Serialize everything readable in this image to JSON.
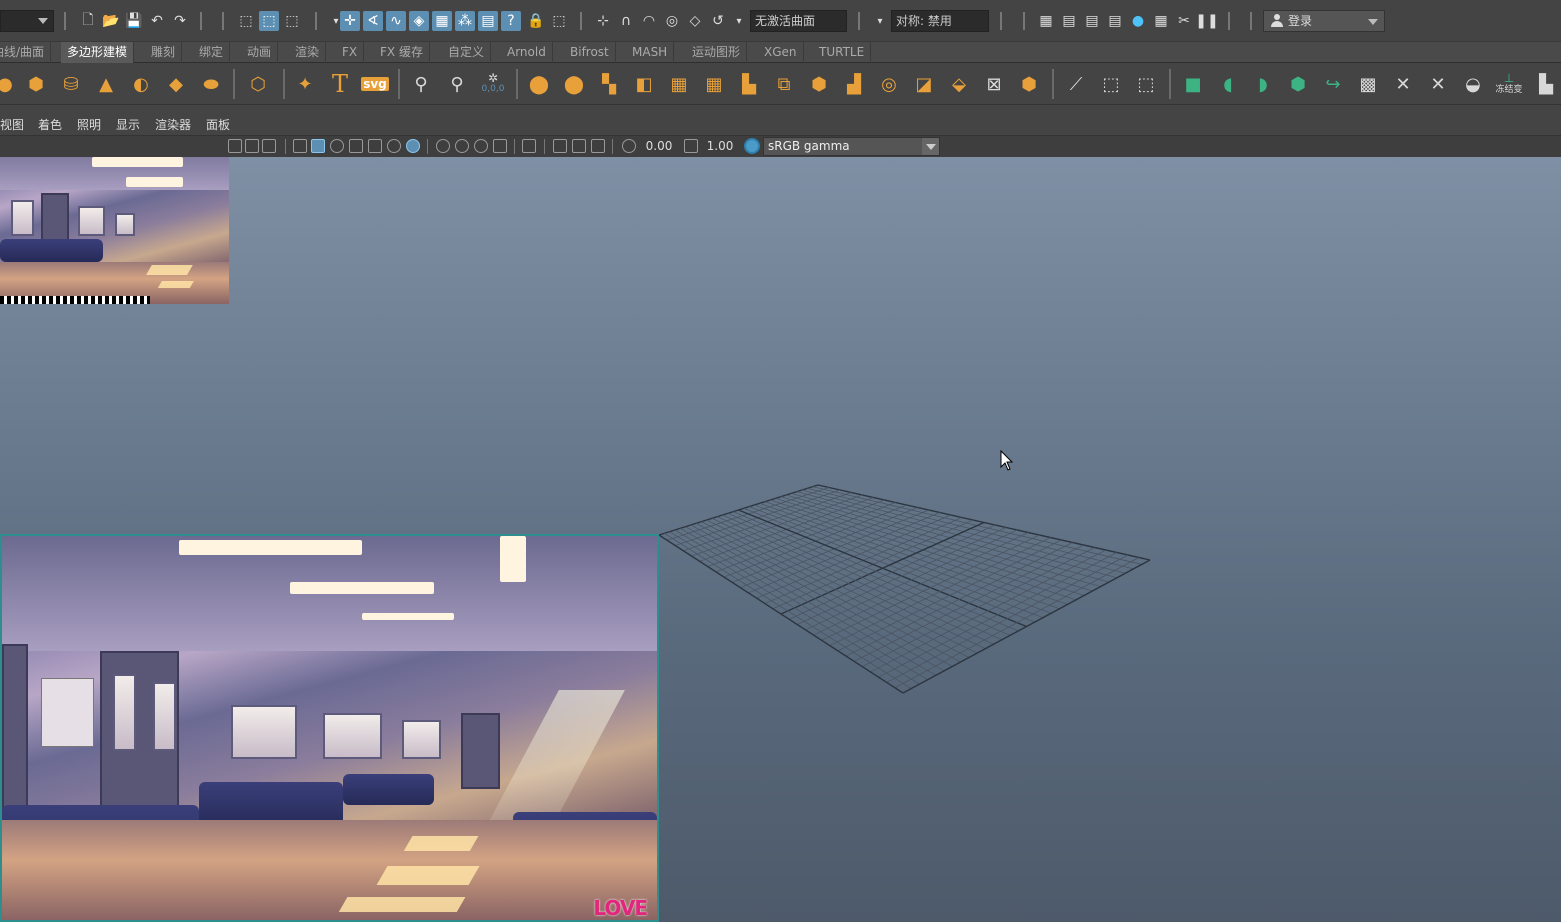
{
  "status_line": {
    "live_surface": "无激活曲面",
    "symmetry": "对称: 禁用",
    "login": "登录"
  },
  "shelf_tabs": [
    {
      "label": "曲线/曲面",
      "active": false
    },
    {
      "label": "多边形建模",
      "active": true
    },
    {
      "label": "雕刻",
      "active": false
    },
    {
      "label": "绑定",
      "active": false
    },
    {
      "label": "动画",
      "active": false
    },
    {
      "label": "渲染",
      "active": false
    },
    {
      "label": "FX",
      "active": false
    },
    {
      "label": "FX 缓存",
      "active": false
    },
    {
      "label": "自定义",
      "active": false
    },
    {
      "label": "Arnold",
      "active": false
    },
    {
      "label": "Bifrost",
      "active": false
    },
    {
      "label": "MASH",
      "active": false
    },
    {
      "label": "运动图形",
      "active": false
    },
    {
      "label": "XGen",
      "active": false
    },
    {
      "label": "TURTLE",
      "active": false
    }
  ],
  "shelf_icons": {
    "text_tool": "T",
    "svg_tool": "svg",
    "snap_readout": "0,0,0",
    "unlock_label": "冻结变"
  },
  "panel_menu": [
    "视图",
    "着色",
    "照明",
    "显示",
    "渲染器",
    "面板"
  ],
  "panel_toolbar": {
    "exposure": "0.00",
    "gamma": "1.00",
    "view_transform": "sRGB gamma"
  },
  "viewport": {
    "image_plane_watermark": "LOVE"
  },
  "colors": {
    "accent": "#5d8fb3",
    "shelf_orange": "#e7a03a",
    "shelf_green": "#3db383",
    "image_frame": "#2e8d8d"
  }
}
